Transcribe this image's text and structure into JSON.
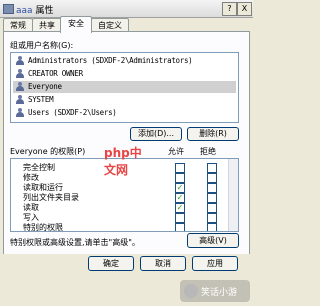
{
  "window": {
    "title_prefix": "aaa",
    "title": "属性",
    "help_button": "?",
    "close_button": "X"
  },
  "tabs": [
    {
      "label": "常规",
      "active": false
    },
    {
      "label": "共享",
      "active": false
    },
    {
      "label": "安全",
      "active": true
    },
    {
      "label": "自定义",
      "active": false
    }
  ],
  "group_users": {
    "label": "组或用户名称(G):",
    "items": [
      {
        "text": "Administrators (SDXDF-2\\Administrators)",
        "selected": false
      },
      {
        "text": "CREATOR OWNER",
        "selected": false
      },
      {
        "text": "Everyone",
        "selected": true
      },
      {
        "text": "SYSTEM",
        "selected": false
      },
      {
        "text": "Users (SDXDF-2\\Users)",
        "selected": false
      }
    ],
    "add_button": "添加(D)...",
    "remove_button": "删除(R)"
  },
  "permissions": {
    "header_label": "Everyone 的权限(P)",
    "allow_label": "允许",
    "deny_label": "拒绝",
    "rows": [
      {
        "name": "完全控制",
        "allow": false,
        "deny": false
      },
      {
        "name": "修改",
        "allow": false,
        "deny": false
      },
      {
        "name": "读取和运行",
        "allow": true,
        "deny": false
      },
      {
        "name": "列出文件夹目录",
        "allow": true,
        "deny": false
      },
      {
        "name": "读取",
        "allow": true,
        "deny": false
      },
      {
        "name": "写入",
        "allow": false,
        "deny": false
      },
      {
        "name": "特别的权限",
        "allow": false,
        "deny": false
      }
    ]
  },
  "advanced": {
    "text": "特别权限或高级设置,请单击\"高级\"。",
    "button": "高级(V)"
  },
  "footer": {
    "ok": "确定",
    "cancel": "取消",
    "apply": "应用"
  },
  "overlay_watermark": {
    "text": "php中文网"
  },
  "corner_watermark": {
    "text": "笑话小游"
  }
}
